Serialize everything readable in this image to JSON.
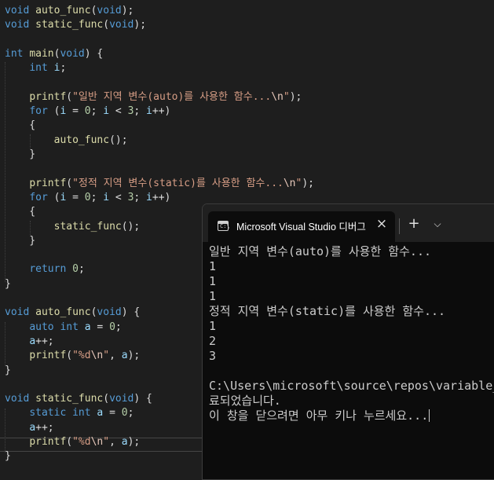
{
  "colors": {
    "editor_background": "#1e1e1e",
    "keyword": "#569cd6",
    "function": "#dcdcaa",
    "string": "#d69d85",
    "number": "#b5cea8",
    "variable": "#9cdcfe",
    "console_background": "#0c0c0c",
    "console_text": "#cccccc"
  },
  "editor": {
    "lines": [
      [
        [
          "kw",
          "void"
        ],
        [
          "pl",
          " "
        ],
        [
          "fn",
          "auto_func"
        ],
        [
          "pl",
          "("
        ],
        [
          "kw",
          "void"
        ],
        [
          "pl",
          ");"
        ]
      ],
      [
        [
          "kw",
          "void"
        ],
        [
          "pl",
          " "
        ],
        [
          "fn",
          "static_func"
        ],
        [
          "pl",
          "("
        ],
        [
          "kw",
          "void"
        ],
        [
          "pl",
          ");"
        ]
      ],
      [],
      [
        [
          "kw",
          "int"
        ],
        [
          "pl",
          " "
        ],
        [
          "fn",
          "main"
        ],
        [
          "pl",
          "("
        ],
        [
          "kw",
          "void"
        ],
        [
          "pl",
          ") {"
        ]
      ],
      [
        [
          "pl",
          "    "
        ],
        [
          "kw",
          "int"
        ],
        [
          "pl",
          " "
        ],
        [
          "var",
          "i"
        ],
        [
          "pl",
          ";"
        ]
      ],
      [],
      [
        [
          "pl",
          "    "
        ],
        [
          "fn",
          "printf"
        ],
        [
          "pl",
          "("
        ],
        [
          "str",
          "\"일반 지역 변수(auto)를 사용한 함수..."
        ],
        [
          "esc",
          "\\n"
        ],
        [
          "str",
          "\""
        ],
        [
          "pl",
          ");"
        ]
      ],
      [
        [
          "pl",
          "    "
        ],
        [
          "kw",
          "for"
        ],
        [
          "pl",
          " ("
        ],
        [
          "var",
          "i"
        ],
        [
          "pl",
          " = "
        ],
        [
          "num",
          "0"
        ],
        [
          "pl",
          "; "
        ],
        [
          "var",
          "i"
        ],
        [
          "pl",
          " < "
        ],
        [
          "num",
          "3"
        ],
        [
          "pl",
          "; "
        ],
        [
          "var",
          "i"
        ],
        [
          "pl",
          "++)"
        ]
      ],
      [
        [
          "pl",
          "    {"
        ]
      ],
      [
        [
          "pl",
          "        "
        ],
        [
          "fn",
          "auto_func"
        ],
        [
          "pl",
          "();"
        ]
      ],
      [
        [
          "pl",
          "    }"
        ]
      ],
      [],
      [
        [
          "pl",
          "    "
        ],
        [
          "fn",
          "printf"
        ],
        [
          "pl",
          "("
        ],
        [
          "str",
          "\"정적 지역 변수(static)를 사용한 함수..."
        ],
        [
          "esc",
          "\\n"
        ],
        [
          "str",
          "\""
        ],
        [
          "pl",
          ");"
        ]
      ],
      [
        [
          "pl",
          "    "
        ],
        [
          "kw",
          "for"
        ],
        [
          "pl",
          " ("
        ],
        [
          "var",
          "i"
        ],
        [
          "pl",
          " = "
        ],
        [
          "num",
          "0"
        ],
        [
          "pl",
          "; "
        ],
        [
          "var",
          "i"
        ],
        [
          "pl",
          " < "
        ],
        [
          "num",
          "3"
        ],
        [
          "pl",
          "; "
        ],
        [
          "var",
          "i"
        ],
        [
          "pl",
          "++)"
        ]
      ],
      [
        [
          "pl",
          "    {"
        ]
      ],
      [
        [
          "pl",
          "        "
        ],
        [
          "fn",
          "static_func"
        ],
        [
          "pl",
          "();"
        ]
      ],
      [
        [
          "pl",
          "    }"
        ]
      ],
      [],
      [
        [
          "pl",
          "    "
        ],
        [
          "kw",
          "return"
        ],
        [
          "pl",
          " "
        ],
        [
          "num",
          "0"
        ],
        [
          "pl",
          ";"
        ]
      ],
      [
        [
          "pl",
          "}"
        ]
      ],
      [],
      [
        [
          "kw",
          "void"
        ],
        [
          "pl",
          " "
        ],
        [
          "fn",
          "auto_func"
        ],
        [
          "pl",
          "("
        ],
        [
          "kw",
          "void"
        ],
        [
          "pl",
          ") {"
        ]
      ],
      [
        [
          "pl",
          "    "
        ],
        [
          "kw",
          "auto"
        ],
        [
          "pl",
          " "
        ],
        [
          "kw",
          "int"
        ],
        [
          "pl",
          " "
        ],
        [
          "var",
          "a"
        ],
        [
          "pl",
          " = "
        ],
        [
          "num",
          "0"
        ],
        [
          "pl",
          ";"
        ]
      ],
      [
        [
          "pl",
          "    "
        ],
        [
          "var",
          "a"
        ],
        [
          "pl",
          "++;"
        ]
      ],
      [
        [
          "pl",
          "    "
        ],
        [
          "fn",
          "printf"
        ],
        [
          "pl",
          "("
        ],
        [
          "str",
          "\"%d"
        ],
        [
          "esc",
          "\\n"
        ],
        [
          "str",
          "\""
        ],
        [
          "pl",
          ", "
        ],
        [
          "var",
          "a"
        ],
        [
          "pl",
          ");"
        ]
      ],
      [
        [
          "pl",
          "}"
        ]
      ],
      [],
      [
        [
          "kw",
          "void"
        ],
        [
          "pl",
          " "
        ],
        [
          "fn",
          "static_func"
        ],
        [
          "pl",
          "("
        ],
        [
          "kw",
          "void"
        ],
        [
          "pl",
          ") {"
        ]
      ],
      [
        [
          "pl",
          "    "
        ],
        [
          "kw",
          "static"
        ],
        [
          "pl",
          " "
        ],
        [
          "kw",
          "int"
        ],
        [
          "pl",
          " "
        ],
        [
          "var",
          "a"
        ],
        [
          "pl",
          " = "
        ],
        [
          "num",
          "0"
        ],
        [
          "pl",
          ";"
        ]
      ],
      [
        [
          "pl",
          "    "
        ],
        [
          "var",
          "a"
        ],
        [
          "pl",
          "++;"
        ]
      ],
      [
        [
          "pl",
          "    "
        ],
        [
          "fn",
          "printf"
        ],
        [
          "pl",
          "("
        ],
        [
          "str",
          "\"%d"
        ],
        [
          "esc",
          "\\n"
        ],
        [
          "str",
          "\""
        ],
        [
          "pl",
          ", "
        ],
        [
          "var",
          "a"
        ],
        [
          "pl",
          ");"
        ]
      ],
      [
        [
          "pl",
          "}"
        ]
      ]
    ]
  },
  "console": {
    "title": "Microsoft Visual Studio 디버그",
    "close_icon": "×",
    "new_tab_icon": "+",
    "dropdown_icon": "⌵",
    "output": [
      "일반 지역 변수(auto)를 사용한 함수...",
      "1",
      "1",
      "1",
      "정적 지역 변수(static)를 사용한 함수...",
      "1",
      "2",
      "3",
      "",
      "C:\\Users\\microsoft\\source\\repos\\variable_",
      "료되었습니다.",
      "이 창을 닫으려면 아무 키나 누르세요..."
    ]
  }
}
